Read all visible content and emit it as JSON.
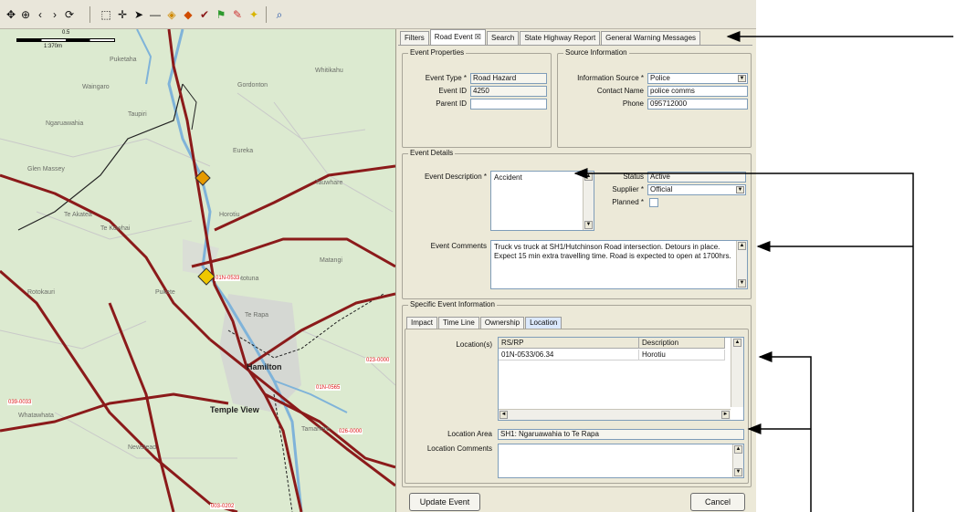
{
  "toolbar": {
    "tools": [
      {
        "icon": "pan-icon",
        "glyph": "✥"
      },
      {
        "icon": "zoom-in-icon",
        "glyph": "⊕"
      },
      {
        "icon": "back-icon",
        "glyph": "‹"
      },
      {
        "icon": "forward-icon",
        "glyph": "›"
      },
      {
        "icon": "refresh-icon",
        "glyph": "⟳"
      },
      {
        "icon": "zoom-box-icon",
        "glyph": "⬚"
      },
      {
        "icon": "crosshair-icon",
        "glyph": "✛"
      },
      {
        "icon": "pointer-icon",
        "glyph": "➤"
      },
      {
        "icon": "line-icon",
        "glyph": "—"
      },
      {
        "icon": "hazard-marker-icon",
        "glyph": "◈"
      },
      {
        "icon": "roadworks-marker-icon",
        "glyph": "◆"
      },
      {
        "icon": "checkmark-icon",
        "glyph": "✔"
      },
      {
        "icon": "flag-icon",
        "glyph": "⚑"
      },
      {
        "icon": "note-icon",
        "glyph": "✎"
      },
      {
        "icon": "star-icon",
        "glyph": "✦"
      },
      {
        "icon": "binoculars-icon",
        "glyph": "⌕"
      }
    ]
  },
  "map": {
    "scale_label": "0.5",
    "scale_unit": "1:370m",
    "place_labels": {
      "temple_view": "Temple View",
      "hamilton": "Hamilton",
      "te_akatea": "Te Akatea",
      "ngaruawahia": "Ngaruawahia",
      "horotiu": "Horotiu",
      "te_rapa": "Te Rapa",
      "gordonton": "Gordonton",
      "puketaha": "Puketaha",
      "te_kowhai": "Te Kowhai",
      "whatawhata": "Whatawhata",
      "eureka": "Eureka",
      "taupiri": "Taupiri",
      "tauwhare": "Tauwhare",
      "matangi": "Matangi",
      "newstead": "Newstead",
      "rototuna": "Rototuna",
      "pukete": "Pukete",
      "glen_massey": "Glen Massey",
      "waingaro": "Waingaro",
      "rotokauri": "Rotokauri",
      "whitikahu": "Whitikahu",
      "tamahere": "Tamahere"
    },
    "road_tags": {
      "sh1_north": "01N-0533",
      "sh1_south": "01N-0565",
      "sh23": "023-0000",
      "sh26": "026-0000",
      "sh3": "003-0202",
      "sh39": "039-0033"
    }
  },
  "panel": {
    "tabs": [
      "Filters",
      "Road Event ☒",
      "Search",
      "State Highway Report",
      "General Warning Messages"
    ],
    "event_properties": {
      "title": "Event Properties",
      "event_type_label": "Event Type *",
      "event_type": "Road Hazard",
      "event_id_label": "Event ID",
      "event_id": "4250",
      "parent_id_label": "Parent ID",
      "parent_id": ""
    },
    "source_information": {
      "title": "Source Information",
      "info_source_label": "Information Source *",
      "info_source": "Police",
      "contact_name_label": "Contact Name",
      "contact_name": "police comms",
      "phone_label": "Phone",
      "phone": "095712000"
    },
    "event_details": {
      "title": "Event Details",
      "description_label": "Event Description *",
      "description": "Accident",
      "status_label": "Status",
      "status": "Active",
      "supplier_label": "Supplier *",
      "supplier": "Official",
      "planned_label": "Planned *",
      "comments_label": "Event Comments",
      "comments": "Truck vs truck at SH1/Hutchinson Road intersection. Detours in place. Expect 15 min extra travelling time.  Road is expected to open at 1700hrs."
    },
    "specific_info": {
      "title": "Specific Event Information",
      "subtabs": [
        "Impact",
        "Time Line",
        "Ownership",
        "Location"
      ],
      "locations_label": "Location(s)",
      "columns": [
        "RS/RP",
        "Description"
      ],
      "rows": [
        [
          "01N-0533/06.34",
          "Horotiu"
        ]
      ],
      "location_area_label": "Location Area",
      "location_area": "SH1: Ngaruawahia to Te Rapa",
      "location_comments_label": "Location Comments",
      "location_comments": ""
    },
    "buttons": {
      "update": "Update Event",
      "cancel": "Cancel"
    }
  },
  "colors": {
    "road": "#8b1a1a",
    "river": "#7fb3d9",
    "map_bg": "#dcead0",
    "panel_bg": "#ece9d8"
  }
}
